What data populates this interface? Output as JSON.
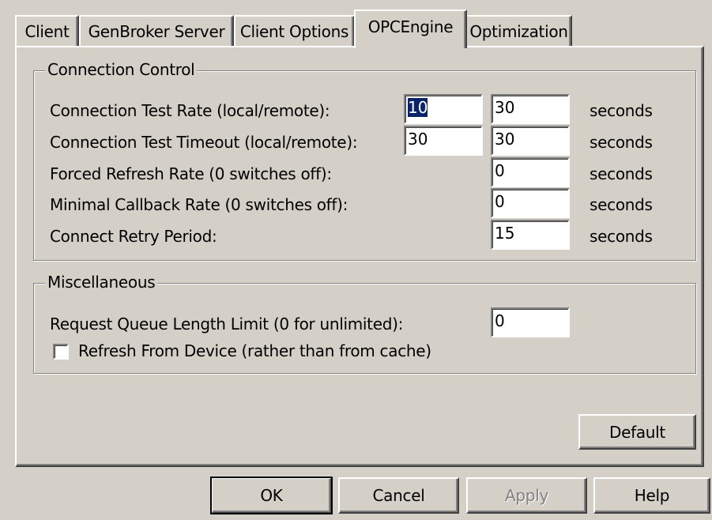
{
  "tabs": [
    {
      "label": "Client",
      "active": false
    },
    {
      "label": "GenBroker Server",
      "active": false
    },
    {
      "label": "Client Options",
      "active": false
    },
    {
      "label": "OPCEngine",
      "active": true
    },
    {
      "label": "Optimization",
      "active": false
    }
  ],
  "connection_control": {
    "title": "Connection Control",
    "rows": [
      {
        "label": "Connection Test Rate (local/remote):",
        "local": "10",
        "remote": "30",
        "unit": "seconds"
      },
      {
        "label": "Connection Test Timeout (local/remote):",
        "local": "30",
        "remote": "30",
        "unit": "seconds"
      },
      {
        "label": "Forced Refresh Rate (0 switches off):",
        "value": "0",
        "unit": "seconds"
      },
      {
        "label": "Minimal Callback Rate (0 switches off):",
        "value": "0",
        "unit": "seconds"
      },
      {
        "label": "Connect Retry Period:",
        "value": "15",
        "unit": "seconds"
      }
    ]
  },
  "miscellaneous": {
    "title": "Miscellaneous",
    "queue_label": "Request Queue Length Limit (0 for unlimited):",
    "queue_value": "0",
    "refresh_checkbox_label": "Refresh From Device (rather than from cache)",
    "refresh_checked": false
  },
  "buttons": {
    "default": "Default",
    "ok": "OK",
    "cancel": "Cancel",
    "apply": "Apply",
    "help": "Help"
  },
  "colors": {
    "face": "#d4d0c8",
    "selection": "#0a246a"
  }
}
